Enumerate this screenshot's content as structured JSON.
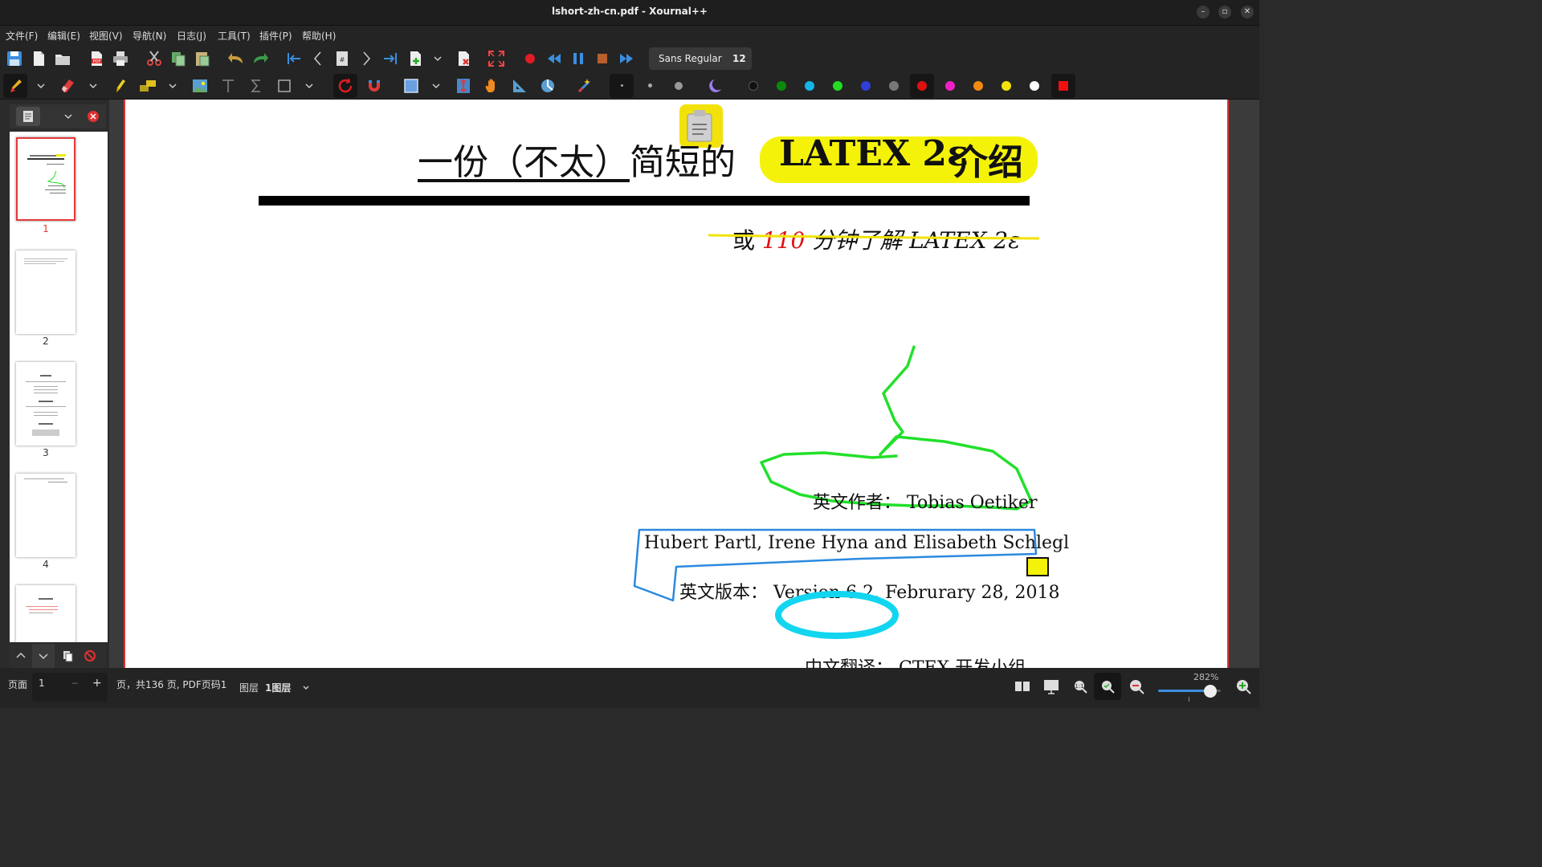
{
  "window": {
    "title": "lshort-zh-cn.pdf - Xournal++"
  },
  "menu": [
    "文件(F)",
    "编辑(E)",
    "视图(V)",
    "导航(N)",
    "日志(J)",
    "工具(T)",
    "插件(P)",
    "帮助(H)"
  ],
  "toolbar": {
    "font_name": "Sans Regular",
    "font_size": "12"
  },
  "colors": {
    "palette": [
      "#111111",
      "#0a8a0a",
      "#12b5e8",
      "#22dd22",
      "#2f3fd8",
      "#777777",
      "#e01010",
      "#f020c8",
      "#f28a10",
      "#f2e20a",
      "#ffffff"
    ],
    "selected": "#e01010",
    "accent": "#e5393b"
  },
  "sidebar": {
    "pages": [
      "1",
      "2",
      "3",
      "4"
    ]
  },
  "doc": {
    "title_part1": "一份（不太）",
    "title_part2": "简短的",
    "title_latex": "LATEX 2ε",
    "title_part3": "介绍",
    "subtitle_pre": "或",
    "subtitle_num": "110",
    "subtitle_post": "分钟了解 LATEX 2ε",
    "author_label": "英文作者：",
    "author_name": "Tobias Oetiker",
    "coauthors": "Hubert Partl, Irene Hyna and Elisabeth Schlegl",
    "version_label": "英文版本：",
    "version_value": "Version 6.2, Februrary 28, 2018",
    "translation_label": "中文翻译：",
    "translation_value": "CTEX 开发小组"
  },
  "status": {
    "page_label": "页面",
    "page_value": "1",
    "minus": "−",
    "plus": "+",
    "page_info": "页，共136 页, PDF页码1",
    "layer_label": "图层",
    "layer_value": "1图层",
    "zoom": "282%"
  }
}
